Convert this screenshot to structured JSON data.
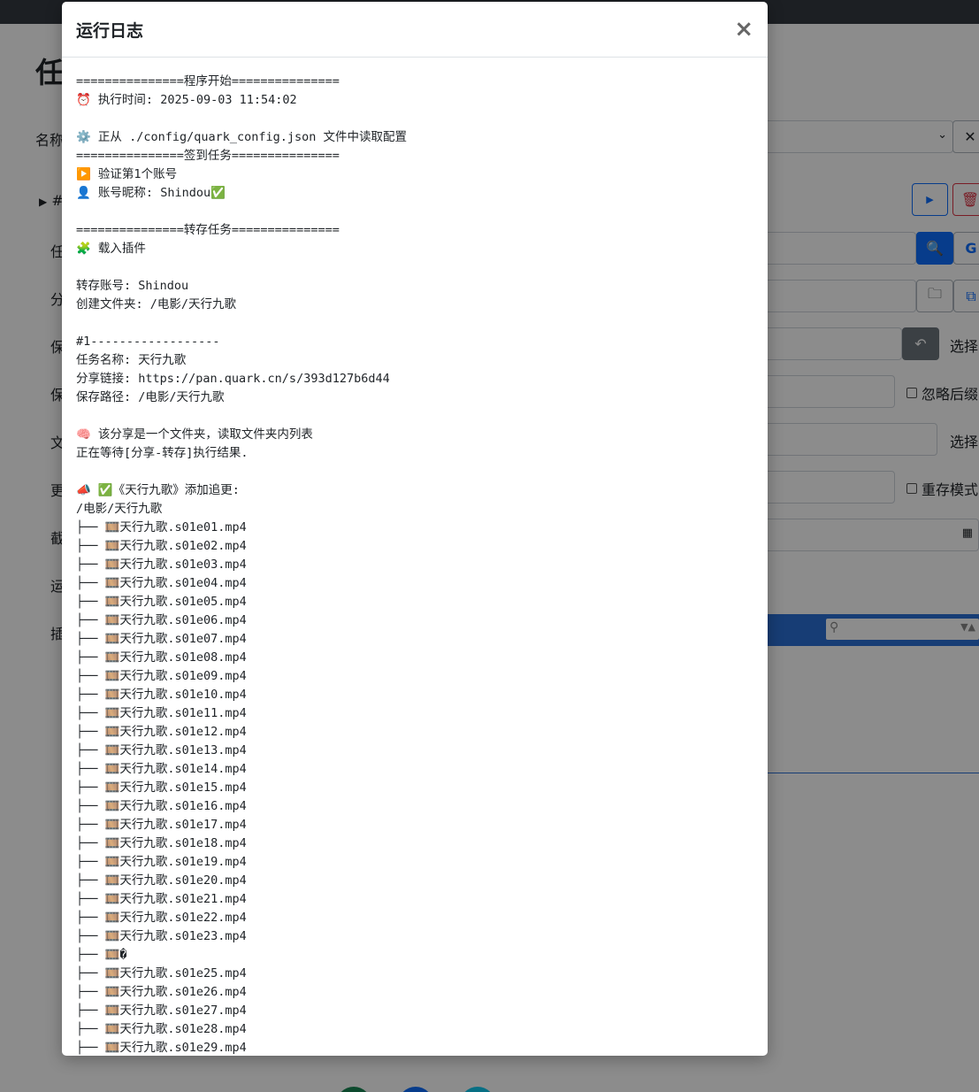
{
  "background": {
    "page_title_fragment": "任",
    "row_labels": [
      "名称",
      "#",
      "任",
      "分",
      "保",
      "保",
      "文",
      "更",
      "截",
      "运",
      "插"
    ],
    "select_label": "选择",
    "ignore_suffix_label": "忽略后缀",
    "select_label_2": "选择",
    "resave_mode_label": "重存模式",
    "google_letter": "G",
    "colors": {
      "topbar": "#343a40",
      "accent": "#0d6efd",
      "danger": "#dc3545",
      "plugin_bar": "#2b6fd6"
    }
  },
  "modal": {
    "title": "运行日志",
    "close_label": "×",
    "log_lines": [
      "===============程序开始===============",
      "⏰ 执行时间: 2025-09-03 11:54:02",
      "",
      "⚙️ 正从 ./config/quark_config.json 文件中读取配置",
      "===============签到任务===============",
      "▶️ 验证第1个账号",
      "👤 账号昵称: Shindou✅",
      "",
      "===============转存任务===============",
      "🧩 载入插件",
      "",
      "转存账号: Shindou",
      "创建文件夹: /电影/天行九歌",
      "",
      "#1------------------",
      "任务名称: 天行九歌",
      "分享链接: https://pan.quark.cn/s/393d127b6d44",
      "保存路径: /电影/天行九歌",
      "",
      "🧠 该分享是一个文件夹，读取文件夹内列表",
      "正在等待[分享-转存]执行结果.",
      "",
      "📣 ✅《天行九歌》添加追更:",
      "/电影/天行九歌",
      "├── 🎞️天行九歌.s01e01.mp4",
      "├── 🎞️天行九歌.s01e02.mp4",
      "├── 🎞️天行九歌.s01e03.mp4",
      "├── 🎞️天行九歌.s01e04.mp4",
      "├── 🎞️天行九歌.s01e05.mp4",
      "├── 🎞️天行九歌.s01e06.mp4",
      "├── 🎞️天行九歌.s01e07.mp4",
      "├── 🎞️天行九歌.s01e08.mp4",
      "├── 🎞️天行九歌.s01e09.mp4",
      "├── 🎞️天行九歌.s01e10.mp4",
      "├── 🎞️天行九歌.s01e11.mp4",
      "├── 🎞️天行九歌.s01e12.mp4",
      "├── 🎞️天行九歌.s01e13.mp4",
      "├── 🎞️天行九歌.s01e14.mp4",
      "├── 🎞️天行九歌.s01e15.mp4",
      "├── 🎞️天行九歌.s01e16.mp4",
      "├── 🎞️天行九歌.s01e17.mp4",
      "├── 🎞️天行九歌.s01e18.mp4",
      "├── 🎞️天行九歌.s01e19.mp4",
      "├── 🎞️天行九歌.s01e20.mp4",
      "├── 🎞️天行九歌.s01e21.mp4",
      "├── 🎞️天行九歌.s01e22.mp4",
      "├── 🎞️天行九歌.s01e23.mp4",
      "├── 🎞️�",
      "├── 🎞️天行九歌.s01e25.mp4",
      "├── 🎞️天行九歌.s01e26.mp4",
      "├── 🎞️天行九歌.s01e27.mp4",
      "├── 🎞️天行九歌.s01e28.mp4",
      "├── 🎞️天行九歌.s01e29.mp4"
    ]
  }
}
